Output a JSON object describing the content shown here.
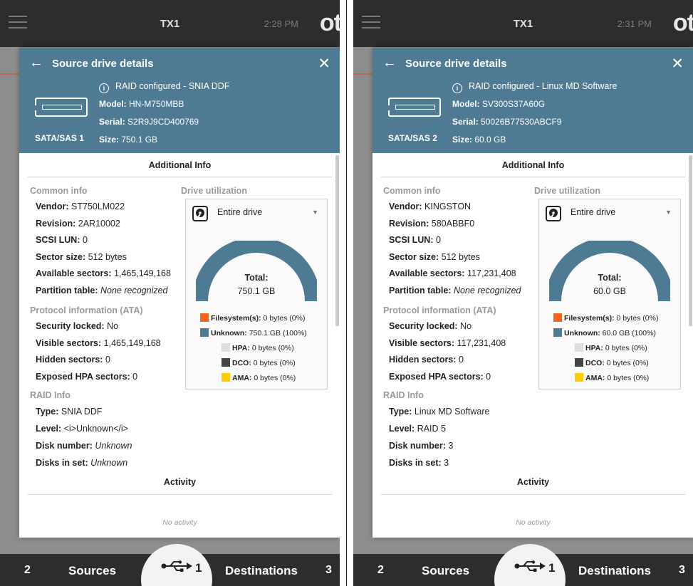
{
  "screens": [
    {
      "topbar": {
        "title": "TX1",
        "time": "2:28 PM",
        "logo": "ot"
      },
      "dialog": {
        "title": "Source drive details",
        "raid_status": "RAID configured - SNIA DDF",
        "drive_label": "SATA/SAS 1",
        "model_label": "Model:",
        "model": "HN-M750MBB",
        "serial_label": "Serial:",
        "serial": "S2R9J9CD400769",
        "size_label": "Size:",
        "size": "750.1 GB"
      },
      "additional_info_title": "Additional Info",
      "common_info_title": "Common info",
      "common_info": [
        {
          "k": "Vendor:",
          "v": "ST750LM022",
          "italic": false
        },
        {
          "k": "Revision:",
          "v": "2AR10002",
          "italic": false
        },
        {
          "k": "SCSI LUN:",
          "v": "0",
          "italic": false
        },
        {
          "k": "Sector size:",
          "v": "512 bytes",
          "italic": false
        },
        {
          "k": "Available sectors:",
          "v": "1,465,149,168",
          "italic": false
        },
        {
          "k": "Partition table:",
          "v": "None recognized",
          "italic": true
        }
      ],
      "protocol_title": "Protocol information (ATA)",
      "protocol_info": [
        {
          "k": "Security locked:",
          "v": "No",
          "italic": false
        },
        {
          "k": "Visible sectors:",
          "v": "1,465,149,168",
          "italic": false
        },
        {
          "k": "Hidden sectors:",
          "v": "0",
          "italic": false
        },
        {
          "k": "Exposed HPA sectors:",
          "v": "0",
          "italic": false
        }
      ],
      "raid_title": "RAID Info",
      "raid_info": [
        {
          "k": "Type:",
          "v": "SNIA DDF",
          "italic": false
        },
        {
          "k": "Level:",
          "v": "<i>Unknown</i>",
          "italic": false
        },
        {
          "k": "Disk number:",
          "v": "Unknown",
          "italic": true
        },
        {
          "k": "Disks in set:",
          "v": "Unknown",
          "italic": true
        }
      ],
      "utilization": {
        "title": "Drive utilization",
        "select_value": "Entire drive",
        "total_label": "Total:",
        "total_value": "750.1 GB",
        "unknown_fraction": 1.0,
        "legend": [
          {
            "name": "Filesystem(s):",
            "value": "0 bytes (0%)",
            "color": "#f26522"
          },
          {
            "name": "Unknown:",
            "value": "750.1 GB (100%)",
            "color": "#4e7a94"
          },
          {
            "name": "HPA:",
            "value": "0 bytes (0%)",
            "color": "#dddddd"
          },
          {
            "name": "DCO:",
            "value": "0 bytes (0%)",
            "color": "#444444"
          },
          {
            "name": "AMA:",
            "value": "0 bytes (0%)",
            "color": "#ffcc00"
          }
        ]
      },
      "activity_title": "Activity",
      "activity_empty": "No activity",
      "bottombar": {
        "left_count": "2",
        "left_label": "Sources",
        "usb_count": "1",
        "right_label": "Destinations",
        "right_count": "3"
      }
    },
    {
      "topbar": {
        "title": "TX1",
        "time": "2:31 PM",
        "logo": "ot"
      },
      "dialog": {
        "title": "Source drive details",
        "raid_status": "RAID configured - Linux MD Software",
        "drive_label": "SATA/SAS 2",
        "model_label": "Model:",
        "model": "SV300S37A60G",
        "serial_label": "Serial:",
        "serial": "50026B77530ABCF9",
        "size_label": "Size:",
        "size": "60.0 GB"
      },
      "additional_info_title": "Additional Info",
      "common_info_title": "Common info",
      "common_info": [
        {
          "k": "Vendor:",
          "v": "KINGSTON",
          "italic": false
        },
        {
          "k": "Revision:",
          "v": "580ABBF0",
          "italic": false
        },
        {
          "k": "SCSI LUN:",
          "v": "0",
          "italic": false
        },
        {
          "k": "Sector size:",
          "v": "512 bytes",
          "italic": false
        },
        {
          "k": "Available sectors:",
          "v": "117,231,408",
          "italic": false
        },
        {
          "k": "Partition table:",
          "v": "None recognized",
          "italic": true
        }
      ],
      "protocol_title": "Protocol information (ATA)",
      "protocol_info": [
        {
          "k": "Security locked:",
          "v": "No",
          "italic": false
        },
        {
          "k": "Visible sectors:",
          "v": "117,231,408",
          "italic": false
        },
        {
          "k": "Hidden sectors:",
          "v": "0",
          "italic": false
        },
        {
          "k": "Exposed HPA sectors:",
          "v": "0",
          "italic": false
        }
      ],
      "raid_title": "RAID Info",
      "raid_info": [
        {
          "k": "Type:",
          "v": "Linux MD Software",
          "italic": false
        },
        {
          "k": "Level:",
          "v": "RAID 5",
          "italic": false
        },
        {
          "k": "Disk number:",
          "v": "3",
          "italic": false
        },
        {
          "k": "Disks in set:",
          "v": "3",
          "italic": false
        }
      ],
      "utilization": {
        "title": "Drive utilization",
        "select_value": "Entire drive",
        "total_label": "Total:",
        "total_value": "60.0 GB",
        "unknown_fraction": 1.0,
        "legend": [
          {
            "name": "Filesystem(s):",
            "value": "0 bytes (0%)",
            "color": "#f26522"
          },
          {
            "name": "Unknown:",
            "value": "60.0 GB (100%)",
            "color": "#4e7a94"
          },
          {
            "name": "HPA:",
            "value": "0 bytes (0%)",
            "color": "#dddddd"
          },
          {
            "name": "DCO:",
            "value": "0 bytes (0%)",
            "color": "#444444"
          },
          {
            "name": "AMA:",
            "value": "0 bytes (0%)",
            "color": "#ffcc00"
          }
        ]
      },
      "activity_title": "Activity",
      "activity_empty": "No activity",
      "bottombar": {
        "left_count": "2",
        "left_label": "Sources",
        "usb_count": "1",
        "right_label": "Destinations",
        "right_count": "3"
      }
    }
  ]
}
